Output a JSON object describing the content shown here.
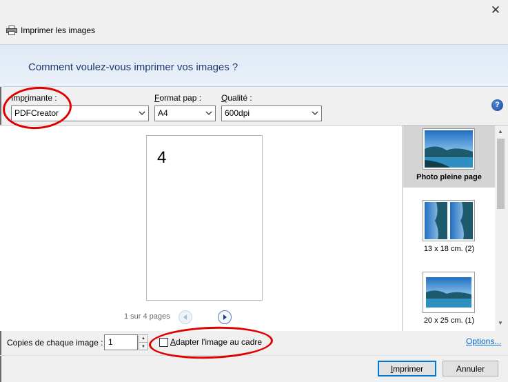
{
  "window": {
    "title": "Imprimer les images",
    "close_glyph": "✕",
    "icon": "printer-icon"
  },
  "banner": {
    "heading": "Comment voulez-vous imprimer vos images ?"
  },
  "options": {
    "printer_label_pre": "Imp",
    "printer_label_accel": "r",
    "printer_label_post": "imante :",
    "printer_value": "PDFCreator",
    "paper_label_accel": "F",
    "paper_label_post": "ormat pap :",
    "paper_value": "A4",
    "quality_label_accel": "Q",
    "quality_label_post": "ualité :",
    "quality_value": "600dpi",
    "help_glyph": "?"
  },
  "preview": {
    "page_number": "4",
    "pager_text": "1 sur 4 pages"
  },
  "layouts": [
    {
      "label": "Photo pleine page",
      "selected": true
    },
    {
      "label": "13 x 18 cm. (2)",
      "selected": false
    },
    {
      "label": "20 x 25 cm. (1)",
      "selected": false
    }
  ],
  "footer": {
    "copies_label": "Copies de chaque image :",
    "copies_value": "1",
    "fit_label_pre": "",
    "fit_label_accel": "A",
    "fit_label_post": "dapter l'image au cadre",
    "fit_checked": false,
    "options_link": "Options...",
    "print_accel": "I",
    "print_label_post": "mprimer",
    "cancel_label": "Annuler"
  },
  "colors": {
    "annotation": "#e00000",
    "link": "#0066cc",
    "banner_text": "#1e3a6e"
  }
}
